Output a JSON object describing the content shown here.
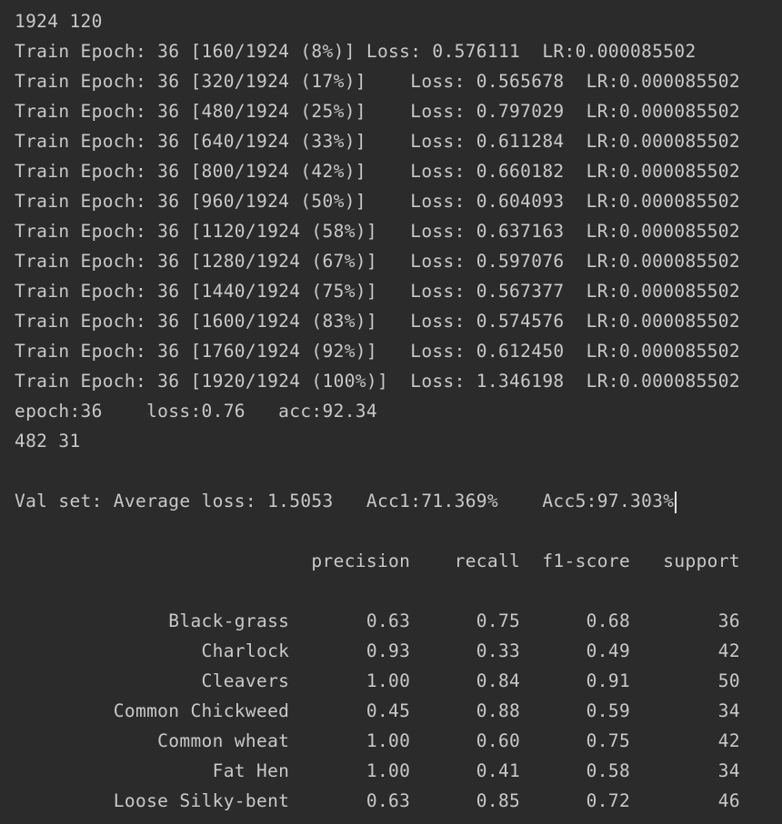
{
  "console": {
    "lines": [
      "1924 120",
      "Train Epoch: 36 [160/1924 (8%)] Loss: 0.576111  LR:0.000085502",
      "Train Epoch: 36 [320/1924 (17%)]    Loss: 0.565678  LR:0.000085502",
      "Train Epoch: 36 [480/1924 (25%)]    Loss: 0.797029  LR:0.000085502",
      "Train Epoch: 36 [640/1924 (33%)]    Loss: 0.611284  LR:0.000085502",
      "Train Epoch: 36 [800/1924 (42%)]    Loss: 0.660182  LR:0.000085502",
      "Train Epoch: 36 [960/1924 (50%)]    Loss: 0.604093  LR:0.000085502",
      "Train Epoch: 36 [1120/1924 (58%)]   Loss: 0.637163  LR:0.000085502",
      "Train Epoch: 36 [1280/1924 (67%)]   Loss: 0.597076  LR:0.000085502",
      "Train Epoch: 36 [1440/1924 (75%)]   Loss: 0.567377  LR:0.000085502",
      "Train Epoch: 36 [1600/1924 (83%)]   Loss: 0.574576  LR:0.000085502",
      "Train Epoch: 36 [1760/1924 (92%)]   Loss: 0.612450  LR:0.000085502",
      "Train Epoch: 36 [1920/1924 (100%)]  Loss: 1.346198  LR:0.000085502",
      "epoch:36    loss:0.76   acc:92.34",
      "482 31",
      "",
      "Val set: Average loss: 1.5053   Acc1:71.369%    Acc5:97.303%",
      "",
      "                           precision    recall  f1-score   support",
      "",
      "              Black-grass       0.63      0.75      0.68        36",
      "                 Charlock       0.93      0.33      0.49        42",
      "                 Cleavers       1.00      0.84      0.91        50",
      "         Common Chickweed       0.45      0.88      0.59        34",
      "             Common wheat       1.00      0.60      0.75        42",
      "                  Fat Hen       1.00      0.41      0.58        34",
      "         Loose Silky-bent       0.63      0.85      0.72        46"
    ]
  }
}
